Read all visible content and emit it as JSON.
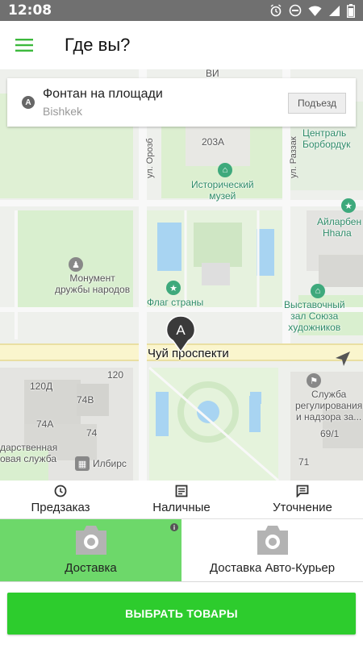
{
  "status_bar": {
    "time": "12:08",
    "icons": [
      "alarm-icon",
      "do-not-disturb-icon",
      "wifi-icon",
      "signal-icon",
      "battery-icon"
    ]
  },
  "app_bar": {
    "title": "Где вы?",
    "menu_icon": "hamburger-menu-icon",
    "accent_color": "#3cb93c"
  },
  "address": {
    "marker": "A",
    "name": "Фонтан на площади",
    "city": "Bishkek",
    "entrance_label": "Подъезд"
  },
  "map": {
    "pin_label": "A",
    "labels": {
      "street_main": "Чуй проспекти",
      "street_orozb": "ул. Орозб",
      "street_razzak": "ул. Раззак",
      "building_203a": "203А",
      "museum": "Исторический\nмузей",
      "monument": "Монумент\nдружбы народов",
      "flag": "Флаг страны",
      "tsentral_1": "Централь",
      "tsentral_2": "Борбордук",
      "ailarben_1": "Айларбен",
      "ailarben_2": "Нhaлa",
      "exhibition": "Выставочный\nзал Союза\nхудожников",
      "service": "Служба\nрегулирования\nи надзора за...",
      "num_120": "120",
      "num_120d": "120Д",
      "num_74v": "74В",
      "num_74a": "74А",
      "num_74": "74",
      "num_69": "69/1",
      "num_71": "71",
      "state_service": "дарственная\nовая служба",
      "ilbirs": "Илбирс",
      "vi_top": "ВИ"
    }
  },
  "options": [
    {
      "icon": "clock-icon",
      "label": "Предзаказ"
    },
    {
      "icon": "receipt-icon",
      "label": "Наличные"
    },
    {
      "icon": "comment-icon",
      "label": "Уточнение"
    }
  ],
  "delivery_tabs": [
    {
      "icon": "camera-icon",
      "label": "Доставка",
      "active": true,
      "info": "i"
    },
    {
      "icon": "camera-icon",
      "label": "Доставка Авто-Курьер",
      "active": false
    }
  ],
  "cta": {
    "label": "ВЫБРАТЬ ТОВАРЫ",
    "color": "#2dcc2d"
  }
}
